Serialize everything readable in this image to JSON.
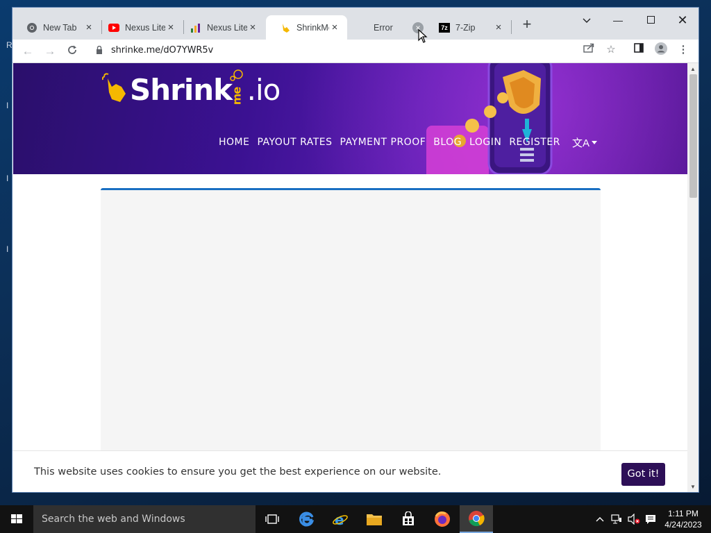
{
  "browser": {
    "tabs": [
      {
        "title": "New Tab",
        "icon": "chrome-icon"
      },
      {
        "title": "Nexus Lite",
        "icon": "youtube-icon"
      },
      {
        "title": "Nexus Lite",
        "icon": "nexus-icon"
      },
      {
        "title": "ShrinkMe",
        "icon": "shrinkme-hand-icon",
        "active": true
      },
      {
        "title": "Error",
        "icon": "",
        "hovered": true
      },
      {
        "title": "7-Zip",
        "icon": "7zip-icon"
      }
    ],
    "url": "shrinke.me/dO7YWR5v"
  },
  "site": {
    "logo_text": "Shrink",
    "logo_me": "me",
    "logo_io": ".io",
    "nav": [
      "HOME",
      "PAYOUT RATES",
      "PAYMENT PROOF",
      "BLOG",
      "LOGIN",
      "REGISTER"
    ],
    "lang_glyph": "文A"
  },
  "cookie": {
    "message": "This website uses cookies to ensure you get the best experience on our website.",
    "button": "Got it!"
  },
  "taskbar": {
    "search_placeholder": "Search the web and Windows",
    "time": "1:11 PM",
    "date": "4/24/2023"
  },
  "colors": {
    "accent_purple": "#2d0f57",
    "content_border": "#1a6fc2"
  }
}
